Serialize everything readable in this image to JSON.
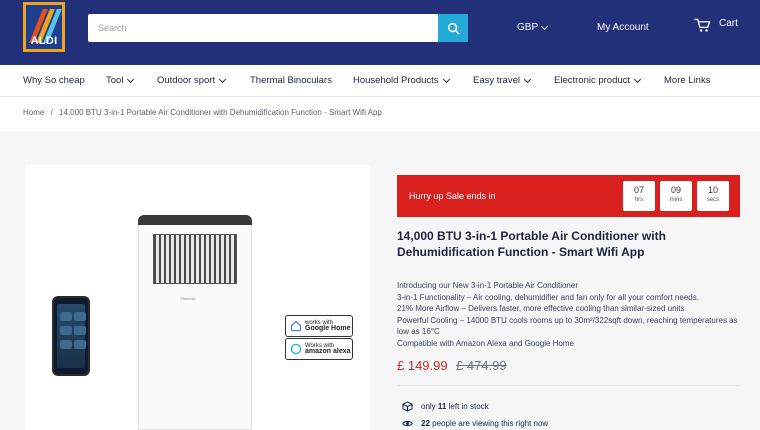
{
  "header": {
    "logo_text": "ALDI",
    "search": {
      "placeholder": "Search",
      "value": ""
    },
    "currency": "GBP",
    "account": "My Account",
    "cart": "Cart"
  },
  "nav": {
    "items": [
      {
        "label": "Why So cheap",
        "dropdown": false
      },
      {
        "label": "Tool",
        "dropdown": true
      },
      {
        "label": "Outdoor sport",
        "dropdown": true
      },
      {
        "label": "Thermal Binoculars",
        "dropdown": false
      },
      {
        "label": "Household Products",
        "dropdown": true
      },
      {
        "label": "Easy travel",
        "dropdown": true
      },
      {
        "label": "Electronic product",
        "dropdown": true
      },
      {
        "label": "More Links",
        "dropdown": false
      }
    ]
  },
  "breadcrumb": {
    "home": "Home",
    "separator": "/",
    "current": "14,000 BTU 3-in-1 Portable Air Conditioner with Dehumidification Function - Smart Wifi App"
  },
  "gallery": {
    "brand_mark": "Hisense",
    "badges": [
      {
        "line1": "works with",
        "line2": "Google Home"
      },
      {
        "line1": "Works with",
        "line2": "amazon alexa"
      }
    ]
  },
  "sale": {
    "label": "Hurry up  Sale ends in",
    "timer": [
      {
        "value": "07",
        "unit": "hrs"
      },
      {
        "value": "09",
        "unit": "mins"
      },
      {
        "value": "10",
        "unit": "secs"
      }
    ]
  },
  "product": {
    "title": "14,000 BTU 3-in-1 Portable Air Conditioner with Dehumidification Function - Smart Wifi App",
    "description": [
      "Introducing our New 3-in-1 Portable Air Conditioner",
      "3-in-1 Functionality – Air cooling, dehumidifier and fan only for all your comfort needs.",
      "21% More Airflow – Delivers faster, more effective cooling than similar-sized units",
      "Powerful Cooling – 14000 BTU cools rooms up to 30m²/322sqft down, reaching temperatures as low as 16°C",
      "Compatible with Amazon Alexa and Google Home"
    ],
    "price": "£ 149.99",
    "old_price": "£ 474.99",
    "stock": {
      "prefix": "only",
      "count": "11",
      "suffix": "left in stock"
    },
    "viewers": {
      "count": "22",
      "suffix": "people are viewing this right now"
    }
  },
  "colors": {
    "header_bg": "#22307a",
    "accent": "#25a9d7",
    "sale_red": "#d9201f",
    "price_red": "#c92a2a",
    "logo_orange": "#f2a31c"
  }
}
